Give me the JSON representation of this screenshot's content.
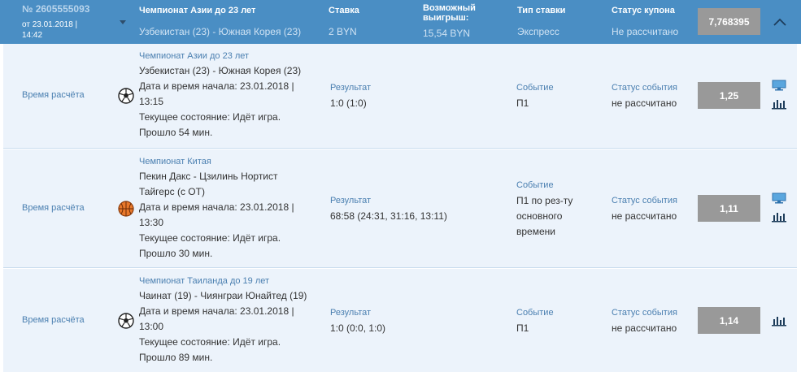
{
  "coupon": {
    "id": "№ 2605555093",
    "date": "от 23.01.2018 | 14:42",
    "event_label": "Чемпионат Азии до 23 лет",
    "event_value": "Узбекистан (23) - Южная Корея (23)",
    "stake_label": "Ставка",
    "stake_value": "2 BYN",
    "win_label": "Возможный выигрыш:",
    "win_value": "15,54 BYN",
    "type_label": "Тип ставки",
    "type_value": "Экспресс",
    "status_label": "Статус купона",
    "status_value": "Не рассчитано",
    "total_odds": "7,768395"
  },
  "bets": [
    {
      "calc_time": "Время расчёта",
      "sport_icon": "soccer-ball-icon",
      "championship": "Чемпионат Азии до 23 лет",
      "teams": "Узбекистан (23) - Южная Корея (23)",
      "start_line1": "Дата и время начала: 23.01.2018 |",
      "start_line2": "13:15",
      "state": "Текущее состояние: Идёт игра.",
      "elapsed": "Прошло 54 мин.",
      "result_label": "Результат",
      "result_value": "1:0 (1:0)",
      "event_label": "Событие",
      "event_value": "П1",
      "event_status_label": "Статус события",
      "event_status_value": "не рассчитано",
      "odds": "1,25"
    },
    {
      "calc_time": "Время расчёта",
      "sport_icon": "basketball-icon",
      "championship": "Чемпионат Китая",
      "teams_line1": "Пекин Дакс - Цзилинь Нортист",
      "teams_line2": "Тайгерс (с ОТ)",
      "start_line1": "Дата и время начала: 23.01.2018 |",
      "start_line2": "13:30",
      "state": "Текущее состояние: Идёт игра.",
      "elapsed": "Прошло 30 мин.",
      "result_label": "Результат",
      "result_value": "68:58 (24:31, 31:16, 13:11)",
      "event_label": "Событие",
      "event_value_line1": "П1 по рез-ту",
      "event_value_line2": "основного",
      "event_value_line3": "времени",
      "event_status_label": "Статус события",
      "event_status_value": "не рассчитано",
      "odds": "1,11"
    },
    {
      "calc_time": "Время расчёта",
      "sport_icon": "soccer-ball-icon",
      "championship": "Чемпионат Таиланда до 19 лет",
      "teams": "Чаинат (19) - Чиянграи Юнайтед (19)",
      "start_line1": "Дата и время начала: 23.01.2018 |",
      "start_line2": "13:00",
      "state": "Текущее состояние: Идёт игра.",
      "elapsed": "Прошло 89 мин.",
      "result_label": "Результат",
      "result_value": "1:0 (0:0, 1:0)",
      "event_label": "Событие",
      "event_value": "П1",
      "event_status_label": "Статус события",
      "event_status_value": "не рассчитано",
      "odds": "1,14"
    }
  ]
}
